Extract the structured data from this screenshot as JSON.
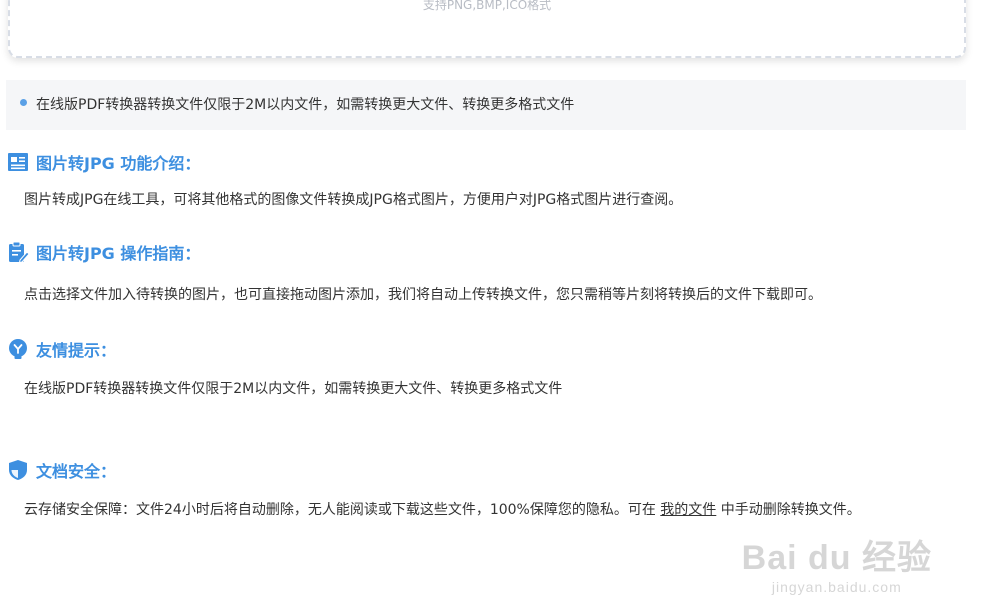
{
  "upload": {
    "hint": "支持PNG,BMP,ICO格式"
  },
  "notice": {
    "text": "在线版PDF转换器转换文件仅限于2M以内文件，如需转换更大文件、转换更多格式文件"
  },
  "sections": {
    "intro": {
      "title": "图片转JPG 功能介绍：",
      "body": "图片转成JPG在线工具，可将其他格式的图像文件转换成JPG格式图片，方便用户对JPG格式图片进行查阅。"
    },
    "guide": {
      "title": "图片转JPG 操作指南：",
      "body": "点击选择文件加入待转换的图片，也可直接拖动图片添加，我们将自动上传转换文件，您只需稍等片刻将转换后的文件下载即可。"
    },
    "tips": {
      "title": "友情提示：",
      "body": "在线版PDF转换器转换文件仅限于2M以内文件，如需转换更大文件、转换更多格式文件"
    },
    "security": {
      "title": "文档安全：",
      "body_before": "云存储安全保障：文件24小时后将自动删除，无人能阅读或下载这些文件，100%保障您的隐私。可在 ",
      "link": "我的文件",
      "body_after": " 中手动删除转换文件。"
    }
  },
  "watermark": {
    "top": "Bai du 经验",
    "bottom": "jingyan.baidu.com"
  },
  "colors": {
    "accent": "#3d8fe0",
    "notice_bg": "#f5f6f8",
    "text": "#333333"
  },
  "icons": {
    "intro": "document-list-icon",
    "guide": "clipboard-pen-icon",
    "tips": "lightbulb-icon",
    "security": "shield-icon"
  }
}
